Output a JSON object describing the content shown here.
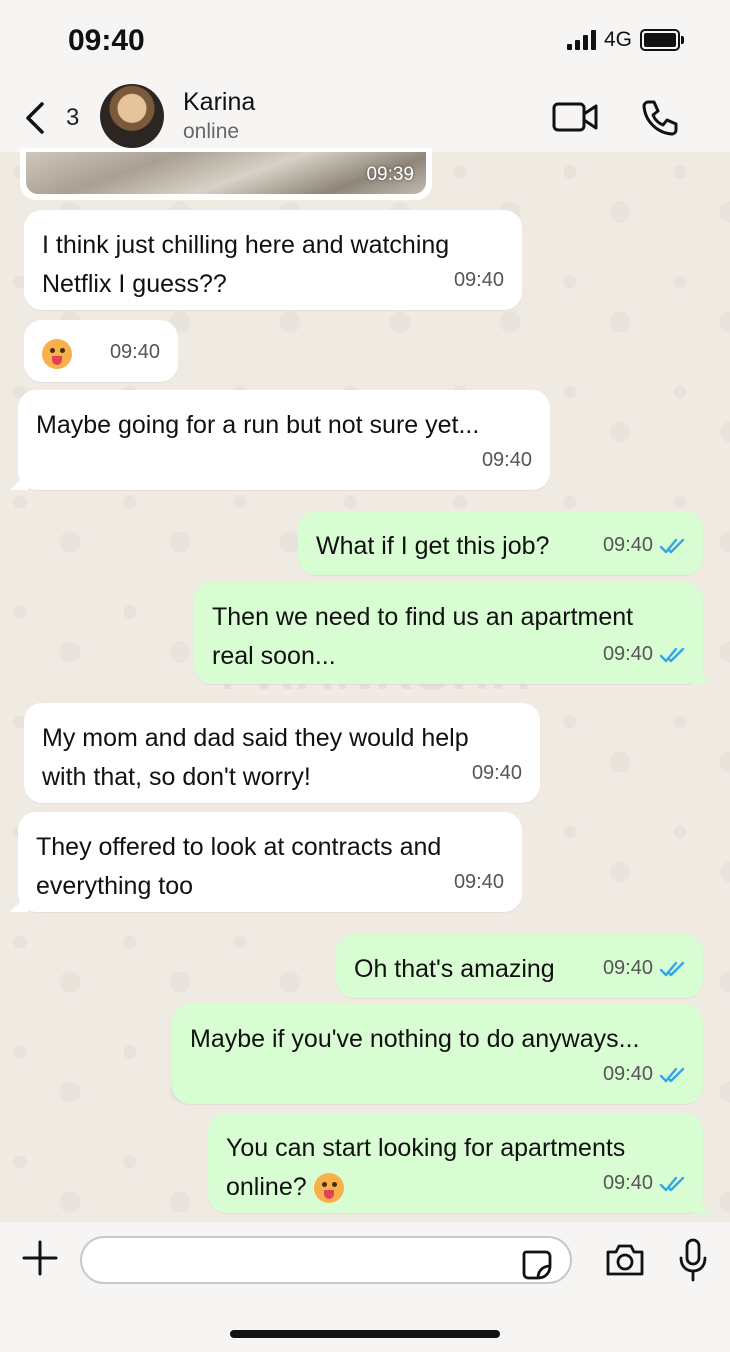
{
  "status_bar": {
    "time": "09:40",
    "network": "4G"
  },
  "header": {
    "back_count": "3",
    "contact_name": "Karina",
    "contact_status": "online"
  },
  "watermark": "PRANKSHIT",
  "image_message": {
    "time": "09:39"
  },
  "messages": [
    {
      "dir": "in",
      "text": "I think just chilling here and watching\nNetflix I guess??",
      "time": "09:40"
    },
    {
      "dir": "in",
      "text": "",
      "emoji": "tongue-face",
      "time": "09:40"
    },
    {
      "dir": "in",
      "text": "Maybe going for a run but not sure yet...",
      "time": "09:40"
    },
    {
      "dir": "out",
      "text": "What if I get this job?",
      "time": "09:40",
      "read": true
    },
    {
      "dir": "out",
      "text": "Then we need to find us an apartment\nreal soon...",
      "time": "09:40",
      "read": true
    },
    {
      "dir": "in",
      "text": "My mom and dad said they would help\nwith that, so don't worry!",
      "time": "09:40"
    },
    {
      "dir": "in",
      "text": "They offered to look at contracts and\neverything too",
      "time": "09:40"
    },
    {
      "dir": "out",
      "text": "Oh that's amazing",
      "time": "09:40",
      "read": true
    },
    {
      "dir": "out",
      "text": "Maybe if you've nothing to do anyways...",
      "time": "09:40",
      "read": true
    },
    {
      "dir": "out",
      "text": "You can start looking for apartments\nonline?",
      "emoji": "winking-tongue-face",
      "time": "09:40",
      "read": true
    }
  ],
  "input": {
    "placeholder": ""
  },
  "colors": {
    "incoming": "#ffffff",
    "outgoing": "#d9fdd3",
    "tick": "#34a5e8"
  }
}
